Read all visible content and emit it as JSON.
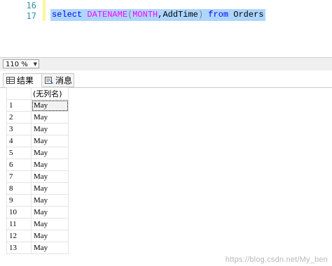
{
  "editor": {
    "line_numbers": [
      "16",
      "17"
    ],
    "code": {
      "t1": "select",
      "t2": " ",
      "t3": "DATENAME",
      "t4": "(",
      "t5": "MONTH",
      "t6": ",AddTime",
      "t7": ")",
      "t8": " from ",
      "t9": "Orders"
    }
  },
  "zoom": {
    "value": "110 %"
  },
  "tabs": {
    "results": "结果",
    "messages": "消息"
  },
  "grid": {
    "column_header": "(无列名)",
    "rows": [
      {
        "num": "1",
        "value": "May"
      },
      {
        "num": "2",
        "value": "May"
      },
      {
        "num": "3",
        "value": "May"
      },
      {
        "num": "4",
        "value": "May"
      },
      {
        "num": "5",
        "value": "May"
      },
      {
        "num": "6",
        "value": "May"
      },
      {
        "num": "7",
        "value": "May"
      },
      {
        "num": "8",
        "value": "May"
      },
      {
        "num": "9",
        "value": "May"
      },
      {
        "num": "10",
        "value": "May"
      },
      {
        "num": "11",
        "value": "May"
      },
      {
        "num": "12",
        "value": "May"
      },
      {
        "num": "13",
        "value": "May"
      }
    ]
  },
  "watermark": "https://blog.csdn.net/My_ben",
  "colors": {
    "keyword": "#0000ff",
    "function": "#ff00ff",
    "selection": "#add6ff",
    "line_number": "#2b91af"
  }
}
